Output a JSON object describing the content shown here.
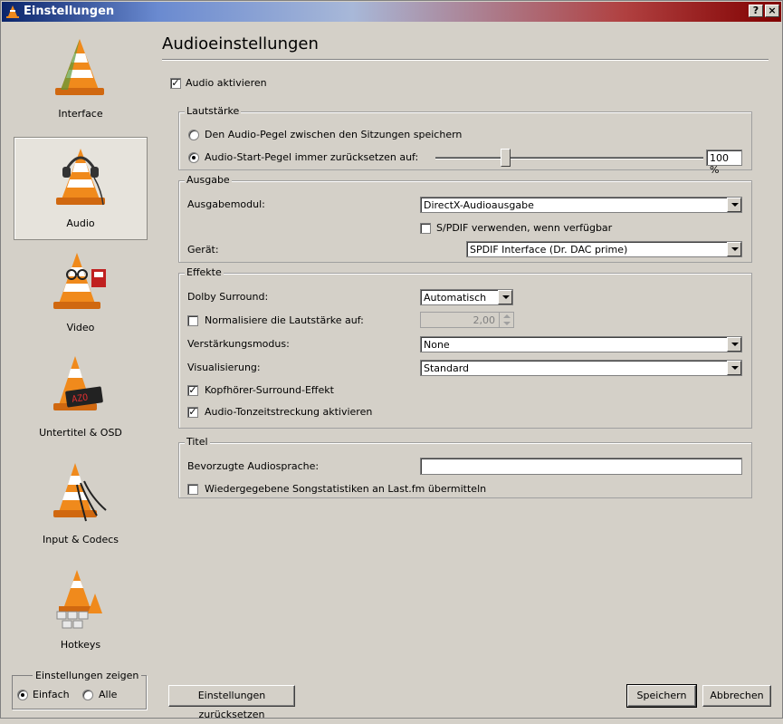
{
  "window": {
    "title": "Einstellungen",
    "help_label": "?",
    "close_label": "×"
  },
  "sidebar": {
    "items": [
      {
        "label": "Interface",
        "selected": false
      },
      {
        "label": "Audio",
        "selected": true
      },
      {
        "label": "Video",
        "selected": false
      },
      {
        "label": "Untertitel & OSD",
        "selected": false
      },
      {
        "label": "Input & Codecs",
        "selected": false
      },
      {
        "label": "Hotkeys",
        "selected": false
      }
    ],
    "show_settings": {
      "title": "Einstellungen zeigen",
      "simple_label": "Einfach",
      "all_label": "Alle",
      "selected": "simple"
    }
  },
  "main": {
    "title": "Audioeinstellungen",
    "enable_audio": {
      "label": "Audio aktivieren",
      "checked": true
    },
    "volume": {
      "title": "Lautstärke",
      "save_level_label": "Den Audio-Pegel zwischen den Sitzungen speichern",
      "reset_level_label": "Audio-Start-Pegel immer zurücksetzen auf:",
      "selected": "reset",
      "slider_fraction": 0.26,
      "value": "100 %"
    },
    "output": {
      "title": "Ausgabe",
      "module_label": "Ausgabemodul:",
      "module_value": "DirectX-Audioausgabe",
      "spdif_label": "S/PDIF verwenden, wenn verfügbar",
      "spdif_checked": false,
      "device_label": "Gerät:",
      "device_value": "SPDIF Interface (Dr. DAC prime)"
    },
    "effects": {
      "title": "Effekte",
      "dolby_label": "Dolby Surround:",
      "dolby_value": "Automatisch",
      "normalize_label": "Normalisiere die Lautstärke auf:",
      "normalize_checked": false,
      "normalize_value": "2,00",
      "gain_label": "Verstärkungsmodus:",
      "gain_value": "None",
      "visual_label": "Visualisierung:",
      "visual_value": "Standard",
      "headphone_label": "Kopfhörer-Surround-Effekt",
      "headphone_checked": true,
      "timestretch_label": "Audio-Tonzeitstreckung aktivieren",
      "timestretch_checked": true
    },
    "track": {
      "title": "Titel",
      "language_label": "Bevorzugte Audiosprache:",
      "language_value": "",
      "lastfm_label": "Wiedergegebene Songstatistiken an Last.fm übermitteln",
      "lastfm_checked": false
    }
  },
  "footer": {
    "reset_label": "Einstellungen zurücksetzen",
    "save_label": "Speichern",
    "cancel_label": "Abbrechen"
  },
  "colors": {
    "cone_orange": "#f08a1c",
    "cone_white": "#ffffff",
    "selection_bg": "#e6e3dc"
  }
}
